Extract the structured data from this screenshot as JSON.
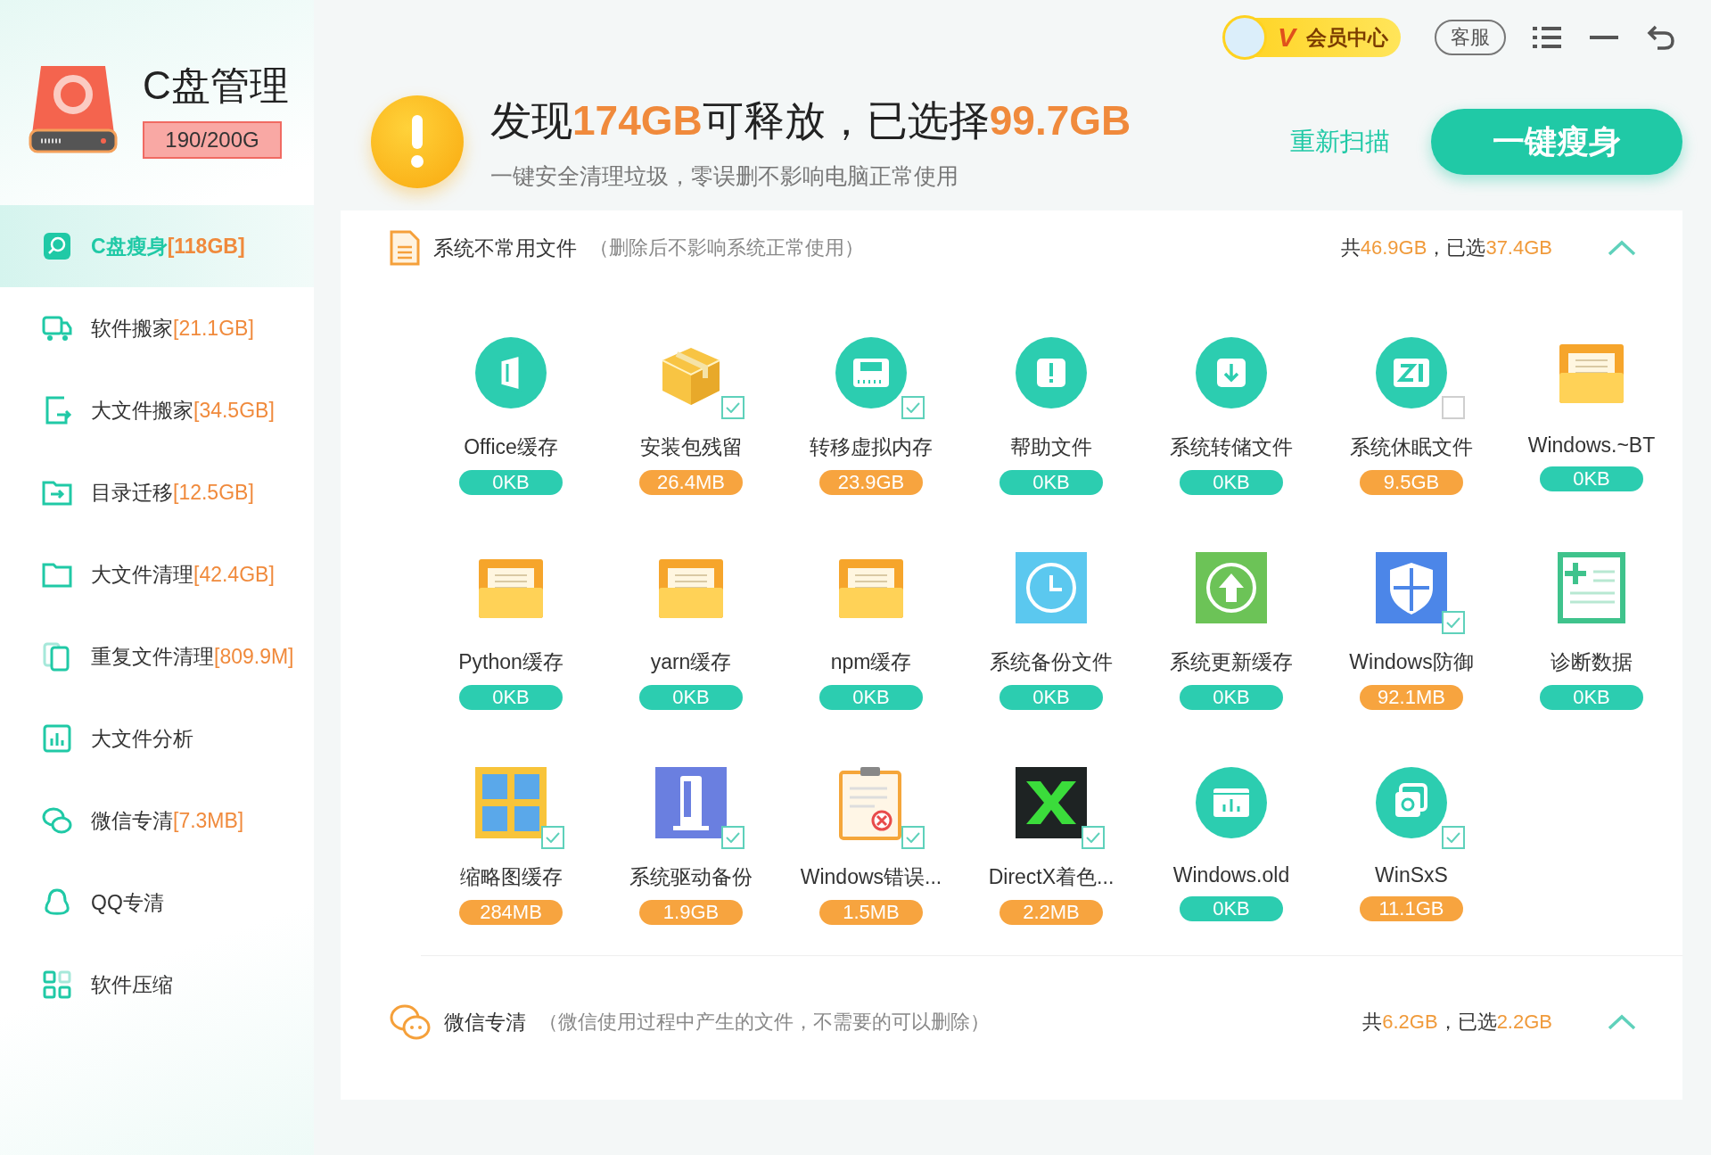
{
  "app": {
    "title": "C盘管理",
    "disk_usage": "190/200G"
  },
  "sidebar": {
    "items": [
      {
        "label": "C盘瘦身",
        "count": "[118GB]",
        "selected": true
      },
      {
        "label": "软件搬家",
        "count": "[21.1GB]",
        "selected": false
      },
      {
        "label": "大文件搬家",
        "count": "[34.5GB]",
        "selected": false
      },
      {
        "label": "目录迁移",
        "count": "[12.5GB]",
        "selected": false
      },
      {
        "label": "大文件清理",
        "count": "[42.4GB]",
        "selected": false
      },
      {
        "label": "重复文件清理",
        "count": "[809.9M]",
        "selected": false
      },
      {
        "label": "大文件分析",
        "selected": false
      },
      {
        "label": "微信专清",
        "count": "[7.3MB]",
        "selected": false
      },
      {
        "label": "QQ专清",
        "selected": false
      },
      {
        "label": "软件压缩",
        "selected": false
      }
    ]
  },
  "topbar": {
    "vip_badge": "V",
    "vip": "会员中心",
    "service": "客服"
  },
  "header": {
    "title": "发现**174GB**可释放，已选择**99.7GB**",
    "subtitle": "一键安全清理垃圾，零误删不影响电脑正常使用",
    "rescan": "重新扫描",
    "primary": "一键瘦身"
  },
  "sections": [
    {
      "title": "系统不常用文件",
      "note": "（删除后不影响系统正常使用）",
      "summary": "共**46.9GB**，已选**37.4GB**",
      "expanded": true,
      "items": [
        {
          "name": "Office缓存",
          "size": "0KB",
          "color": "#2ccdb0"
        },
        {
          "name": "安装包残留",
          "size": "26.4MB",
          "color": "#f7a43f",
          "checked": true
        },
        {
          "name": "转移虚拟内存",
          "size": "23.9GB",
          "color": "#f7a43f",
          "checked": true
        },
        {
          "name": "帮助文件",
          "size": "0KB",
          "color": "#2ccdb0"
        },
        {
          "name": "系统转储文件",
          "size": "0KB",
          "color": "#2ccdb0"
        },
        {
          "name": "系统休眠文件",
          "size": "9.5GB",
          "color": "#f7a43f",
          "checked": false
        },
        {
          "name": "Windows.~BT",
          "size": "0KB",
          "color": "#2ccdb0"
        },
        {
          "name": "Python缓存",
          "size": "0KB",
          "color": "#2ccdb0"
        },
        {
          "name": "yarn缓存",
          "size": "0KB",
          "color": "#2ccdb0"
        },
        {
          "name": "npm缓存",
          "size": "0KB",
          "color": "#2ccdb0"
        },
        {
          "name": "系统备份文件",
          "size": "0KB",
          "color": "#2ccdb0"
        },
        {
          "name": "系统更新缓存",
          "size": "0KB",
          "color": "#2ccdb0"
        },
        {
          "name": "Windows防御",
          "size": "92.1MB",
          "color": "#f7a43f",
          "checked": true
        },
        {
          "name": "诊断数据",
          "size": "0KB",
          "color": "#2ccdb0"
        },
        {
          "name": "缩略图缓存",
          "size": "284MB",
          "color": "#f7a43f",
          "checked": true
        },
        {
          "name": "系统驱动备份",
          "size": "1.9GB",
          "color": "#f7a43f",
          "checked": true
        },
        {
          "name": "Windows错误...",
          "size": "1.5MB",
          "color": "#f7a43f",
          "checked": true
        },
        {
          "name": "DirectX着色...",
          "size": "2.2MB",
          "color": "#f7a43f",
          "checked": true
        },
        {
          "name": "Windows.old",
          "size": "0KB",
          "color": "#2ccdb0"
        },
        {
          "name": "WinSxS",
          "size": "11.1GB",
          "color": "#f7a43f",
          "checked": true
        }
      ]
    },
    {
      "title": "微信专清",
      "note": "（微信使用过程中产生的文件，不需要的可以删除）",
      "summary": "共**6.2GB**，已选**2.2GB**",
      "expanded": true
    }
  ]
}
